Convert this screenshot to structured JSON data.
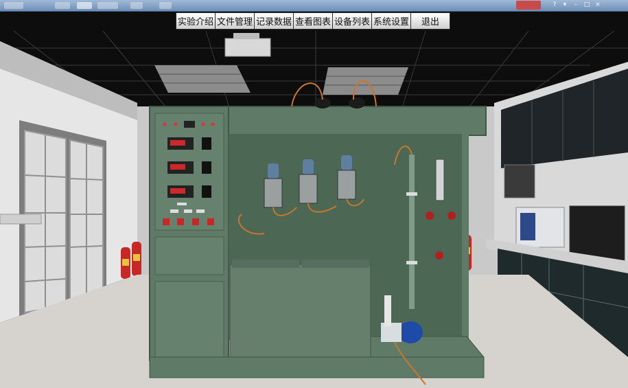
{
  "menu": {
    "items": [
      {
        "label": "实验介绍"
      },
      {
        "label": "文件管理"
      },
      {
        "label": "记录数据"
      },
      {
        "label": "查看图表"
      },
      {
        "label": "设备列表"
      },
      {
        "label": "系统设置"
      },
      {
        "label": "退出"
      }
    ]
  },
  "colors": {
    "equipment": "#5f7a66",
    "menu_border": "#2e2e2e",
    "ceiling": "#0d0d0d",
    "floor": "#d6d3ce"
  }
}
